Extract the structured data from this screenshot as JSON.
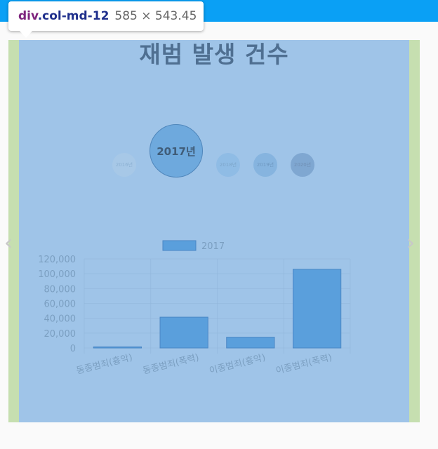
{
  "tooltip": {
    "tag": "div",
    "class": ".col-md-12",
    "size": "585 × 543.45"
  },
  "title": "재범 발생 건수",
  "years": {
    "selected": "2017년",
    "others": [
      "2016년",
      "2018년",
      "2019년",
      "2020년"
    ]
  },
  "navigation": {
    "prev_icon": "chevron-left-icon",
    "next_icon": "chevron-right-icon"
  },
  "colors": {
    "bar_fill": "#5a9fdc",
    "bar_stroke": "#4a86c4",
    "axis_text": "#7b9fc1",
    "grid": "#8fb4d9",
    "title": "#4f6f91"
  },
  "chart_data": {
    "type": "bar",
    "categories": [
      "동종범죄(흉악)",
      "동종범죄(폭력)",
      "이종범죄(흉악)",
      "이종범죄(폭력)"
    ],
    "series": [
      {
        "name": "2017",
        "values": [
          1500,
          41500,
          14500,
          106000
        ]
      }
    ],
    "yticks": [
      "120,000",
      "100,000",
      "80,000",
      "60,000",
      "40,000",
      "20,000",
      "0"
    ],
    "ylim": [
      0,
      120000
    ],
    "legend_position": "top-center",
    "grid": true
  }
}
